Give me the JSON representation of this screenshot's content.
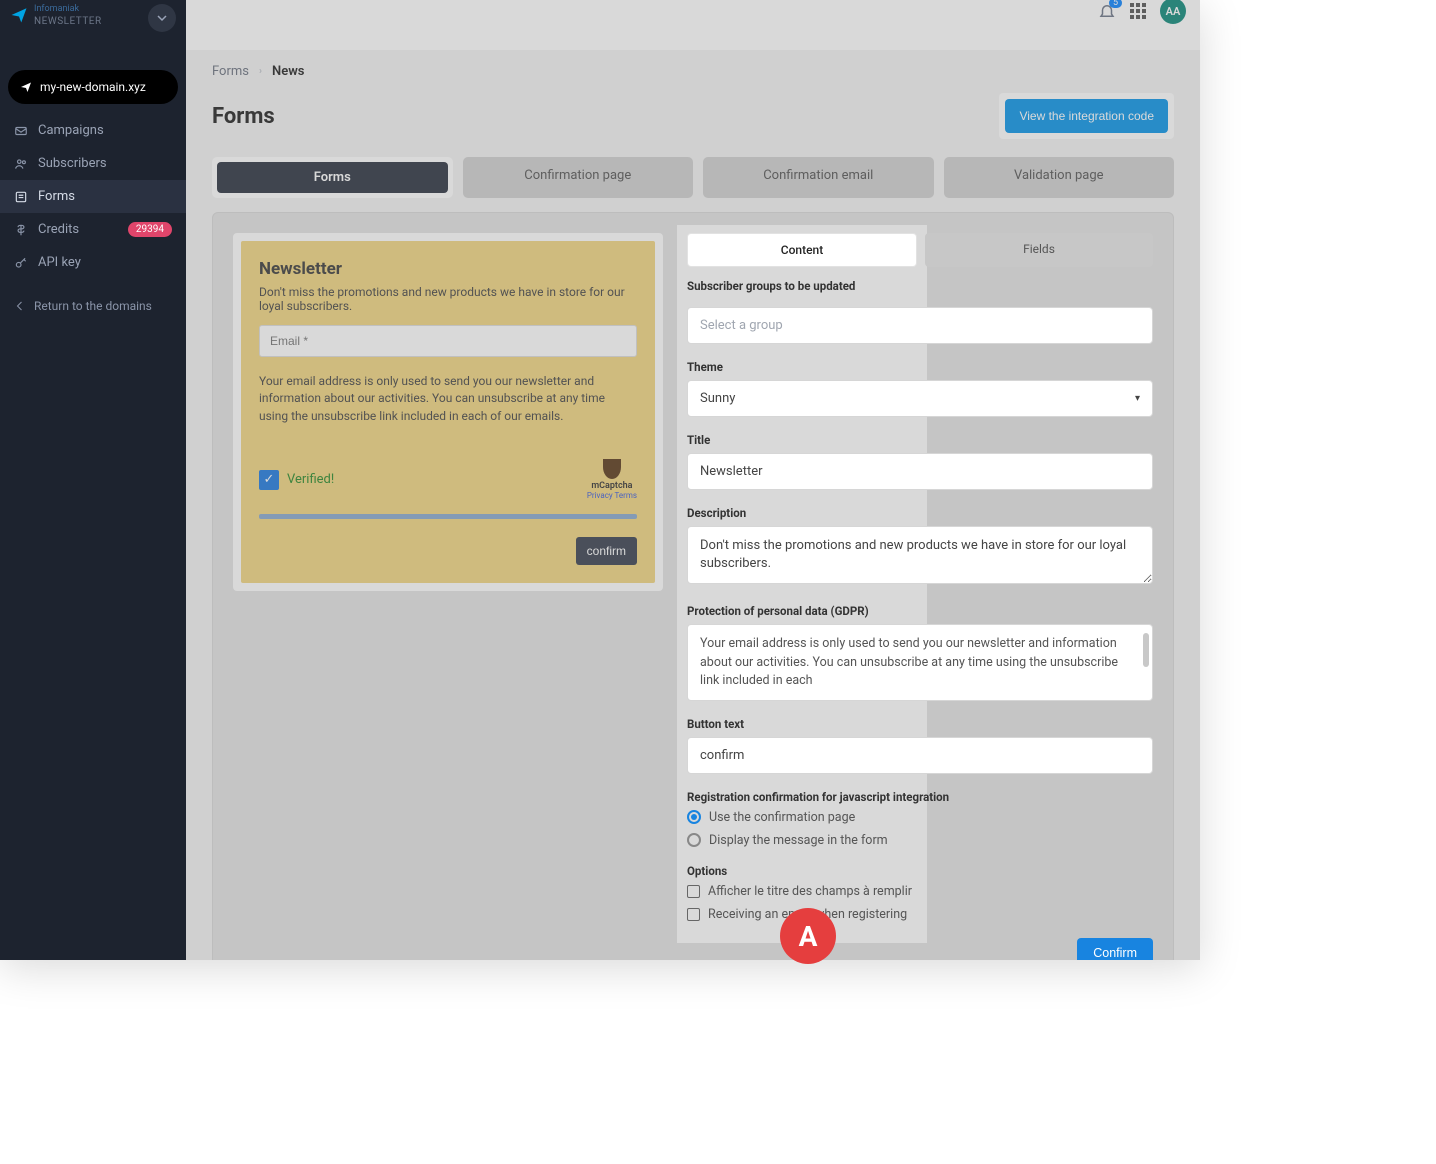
{
  "brand": {
    "product": "Infomaniak",
    "subtitle": "NEWSLETTER"
  },
  "topbar": {
    "notif_count": "5",
    "avatar_initials": "AA"
  },
  "sidebar": {
    "domain": "my-new-domain.xyz",
    "items": [
      {
        "label": "Campaigns",
        "icon": "mail-icon"
      },
      {
        "label": "Subscribers",
        "icon": "users-icon"
      },
      {
        "label": "Forms",
        "icon": "form-icon",
        "active": true
      },
      {
        "label": "Credits",
        "icon": "credits-icon",
        "badge": "29394"
      },
      {
        "label": "API key",
        "icon": "key-icon"
      }
    ],
    "return_label": "Return to the domains"
  },
  "breadcrumbs": {
    "root": "Forms",
    "current": "News"
  },
  "page": {
    "title": "Forms",
    "integration_button": "View the integration code"
  },
  "tabs": [
    {
      "label": "Forms",
      "active": true
    },
    {
      "label": "Confirmation page"
    },
    {
      "label": "Confirmation email"
    },
    {
      "label": "Validation page"
    }
  ],
  "preview": {
    "title": "Newsletter",
    "description": "Don't miss the promotions and new products we have in store for our loyal subscribers.",
    "email_placeholder": "Email *",
    "gdpr": "Your email address is only used to send you our newsletter and information about our activities. You can unsubscribe at any time using the unsubscribe link included in each of our emails.",
    "verified_label": "Verified!",
    "captcha_name": "mCaptcha",
    "captcha_links": "Privacy  Terms",
    "confirm_label": "confirm"
  },
  "settings": {
    "tabs": {
      "content": "Content",
      "fields": "Fields"
    },
    "groups_label": "Subscriber groups to be updated",
    "groups_placeholder": "Select a group",
    "theme_label": "Theme",
    "theme_value": "Sunny",
    "title_label": "Title",
    "title_value": "Newsletter",
    "description_label": "Description",
    "description_value": "Don't miss the promotions and new products we have in store for our loyal subscribers.",
    "gdpr_label": "Protection of personal data (GDPR)",
    "gdpr_value": "Your email address is only used to send you our newsletter and information about our activities. You can unsubscribe at any time using the unsubscribe link included in each",
    "button_text_label": "Button text",
    "button_text_value": "confirm",
    "confirmation_label": "Registration confirmation for javascript integration",
    "radio_confirmation_page": "Use the confirmation page",
    "radio_display_message": "Display the message in the form",
    "options_label": "Options",
    "check_show_titles": "Afficher le titre des champs à remplir",
    "check_receive_email": "Receiving an email when registering",
    "footer_confirm": "Confirm"
  },
  "badge_letter": "A"
}
